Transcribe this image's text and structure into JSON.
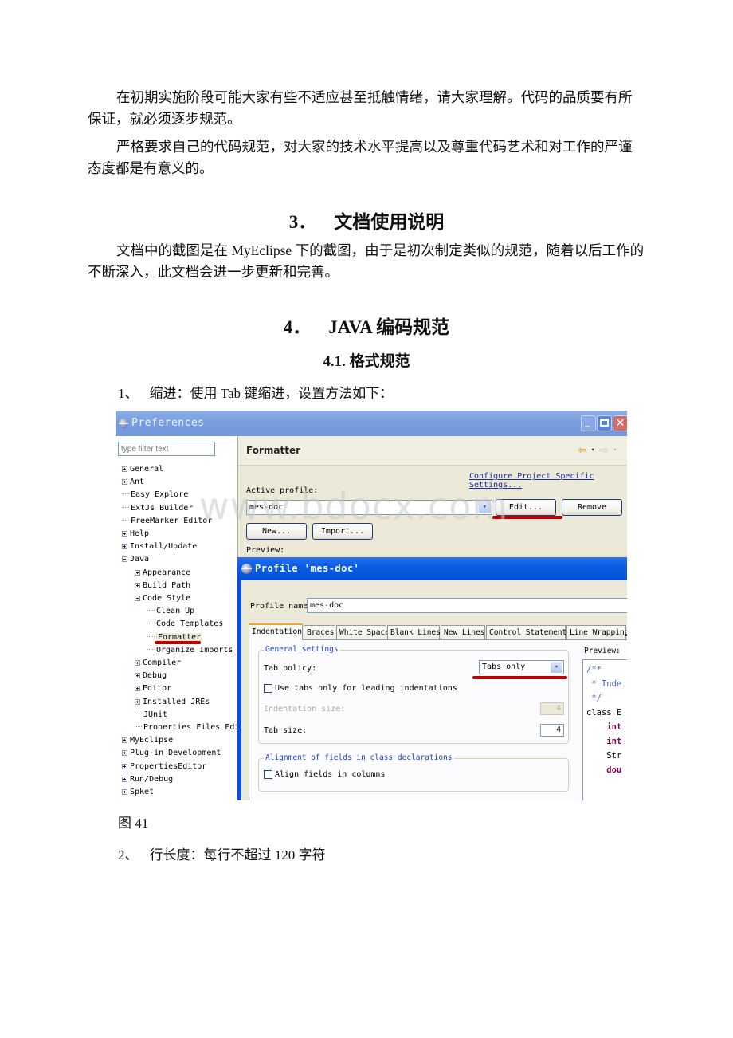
{
  "document": {
    "para1": "在初期实施阶段可能大家有些不适应甚至抵触情绪，请大家理解。代码的品质要有所保证，就必须逐步规范。",
    "para2": "严格要求自己的代码规范，对大家的技术水平提高以及尊重代码艺术和对工作的严谨态度都是有意义的。",
    "section3": {
      "number": "3．",
      "title": "文档使用说明"
    },
    "para3": "文档中的截图是在 MyEclipse 下的截图，由于是初次制定类似的规范，随着以后工作的不断深入，此文档会进一步更新和完善。",
    "section4": {
      "number": "4．",
      "title": "JAVA 编码规范"
    },
    "section41": {
      "title": "4.1. 格式规范"
    },
    "item1": {
      "number": "1、",
      "text": "缩进：使用 Tab 键缩进，设置方法如下："
    },
    "figure_caption": "图 41",
    "item2": {
      "number": "2、",
      "text": "行长度：每行不超过 120 字符"
    },
    "watermark": "www.bdocx.com"
  },
  "preferences_window": {
    "title": "Preferences",
    "window_controls": {
      "minimize": "minimize",
      "maximize": "maximize",
      "close": "✕"
    },
    "filter_placeholder": "type filter text",
    "tree": [
      {
        "label": "General",
        "level": 0,
        "expander": "plus"
      },
      {
        "label": "Ant",
        "level": 0,
        "expander": "plus"
      },
      {
        "label": "Easy Explore",
        "level": 0,
        "expander": "none"
      },
      {
        "label": "ExtJs Builder",
        "level": 0,
        "expander": "none"
      },
      {
        "label": "FreeMarker Editor",
        "level": 0,
        "expander": "none"
      },
      {
        "label": "Help",
        "level": 0,
        "expander": "plus"
      },
      {
        "label": "Install/Update",
        "level": 0,
        "expander": "plus"
      },
      {
        "label": "Java",
        "level": 0,
        "expander": "minus"
      },
      {
        "label": "Appearance",
        "level": 1,
        "expander": "plus"
      },
      {
        "label": "Build Path",
        "level": 1,
        "expander": "plus"
      },
      {
        "label": "Code Style",
        "level": 1,
        "expander": "minus"
      },
      {
        "label": "Clean Up",
        "level": 2,
        "expander": "none"
      },
      {
        "label": "Code Templates",
        "level": 2,
        "expander": "none"
      },
      {
        "label": "Formatter",
        "level": 2,
        "expander": "none",
        "selected": true
      },
      {
        "label": "Organize Imports",
        "level": 2,
        "expander": "none"
      },
      {
        "label": "Compiler",
        "level": 1,
        "expander": "plus"
      },
      {
        "label": "Debug",
        "level": 1,
        "expander": "plus"
      },
      {
        "label": "Editor",
        "level": 1,
        "expander": "plus"
      },
      {
        "label": "Installed JREs",
        "level": 1,
        "expander": "plus"
      },
      {
        "label": "JUnit",
        "level": 1,
        "expander": "none"
      },
      {
        "label": "Properties Files Editc",
        "level": 1,
        "expander": "none"
      },
      {
        "label": "MyEclipse",
        "level": 0,
        "expander": "plus"
      },
      {
        "label": "Plug-in Development",
        "level": 0,
        "expander": "plus"
      },
      {
        "label": "PropertiesEditor",
        "level": 0,
        "expander": "plus"
      },
      {
        "label": "Run/Debug",
        "level": 0,
        "expander": "plus"
      },
      {
        "label": "Spket",
        "level": 0,
        "expander": "plus"
      }
    ],
    "page": {
      "title": "Formatter",
      "nav_back": "⇦",
      "nav_forward": "⇨",
      "nav_dropdown": "▾",
      "configure_link": "Configure Project Specific Settings...",
      "active_profile_label": "Active profile:",
      "active_profile_value": "mes-doc",
      "combo_arrow": "▾",
      "edit_button": "Edit...",
      "remove_button": "Remove",
      "new_button": "New...",
      "import_button": "Import...",
      "preview_label": "Preview:"
    }
  },
  "profile_dialog": {
    "title": "Profile 'mes-doc'",
    "profile_name_label": "Profile name:",
    "profile_name_value": "mes-doc",
    "tabs": [
      "Indentation",
      "Braces",
      "White Space",
      "Blank Lines",
      "New Lines",
      "Control Statements",
      "Line Wrapping"
    ],
    "active_tab": "Indentation",
    "general_settings": {
      "title": "General settings",
      "tab_policy_label": "Tab policy:",
      "tab_policy_value": "Tabs only",
      "use_tabs_leading_label": "Use tabs only for leading indentations",
      "use_tabs_leading_checked": false,
      "indentation_size_label": "Indentation size:",
      "indentation_size_value": "4",
      "tab_size_label": "Tab size:",
      "tab_size_value": "4"
    },
    "alignment": {
      "title": "Alignment of fields in class declarations",
      "align_fields_label": "Align fields in columns",
      "align_fields_checked": false
    },
    "preview_label": "Preview:",
    "preview_lines": [
      {
        "text": "/**",
        "kind": "comment"
      },
      {
        "text": " * Inde",
        "kind": "comment"
      },
      {
        "text": " */",
        "kind": "comment"
      },
      {
        "text": "class E",
        "kind": "class"
      },
      {
        "text": "    int",
        "kind": "keyword"
      },
      {
        "text": "    int",
        "kind": "keyword"
      },
      {
        "text": "    Str",
        "kind": "plain"
      },
      {
        "text": "    dou",
        "kind": "keyword"
      }
    ]
  },
  "colors": {
    "annotation_red": "#c00000",
    "xp_title_blue": "#0553d8",
    "link_blue": "#1d2aa8",
    "group_title_blue": "#1d45c3",
    "keyword_purple": "#7f0055",
    "comment_blue": "#3f5fbf"
  }
}
